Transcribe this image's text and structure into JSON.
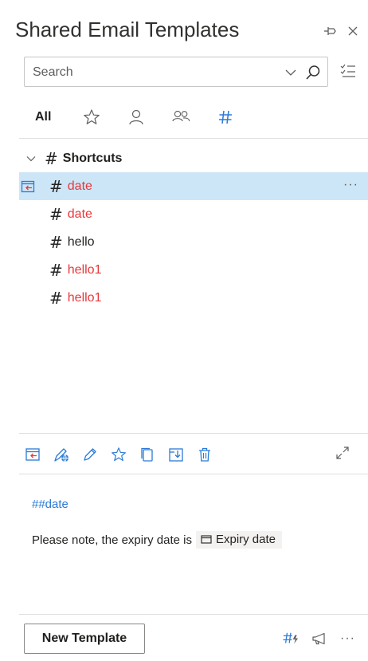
{
  "header": {
    "title": "Shared Email Templates",
    "pin_icon": "pin-icon",
    "close_icon": "close-icon"
  },
  "search": {
    "placeholder": "Search",
    "value": ""
  },
  "filters": {
    "all_label": "All",
    "icons": [
      "star-icon",
      "person-icon",
      "people-icon",
      "hashtag-icon"
    ]
  },
  "tree": {
    "group": {
      "label": "Shortcuts"
    },
    "items": [
      {
        "label": "date",
        "color": "red",
        "selected": true
      },
      {
        "label": "date",
        "color": "red",
        "selected": false
      },
      {
        "label": "hello",
        "color": "dark",
        "selected": false
      },
      {
        "label": "hello1",
        "color": "red",
        "selected": false
      },
      {
        "label": "hello1",
        "color": "red",
        "selected": false
      }
    ],
    "row_more": "···"
  },
  "preview": {
    "title": "##date",
    "body_text": "Please note, the expiry date is",
    "field_label": "Expiry date"
  },
  "footer": {
    "new_template_label": "New Template",
    "more": "···"
  },
  "colors": {
    "accent": "#2b7bd6",
    "red_item": "#e8373a",
    "selected_bg": "#cde6f7",
    "divider": "#e1dfdd"
  }
}
